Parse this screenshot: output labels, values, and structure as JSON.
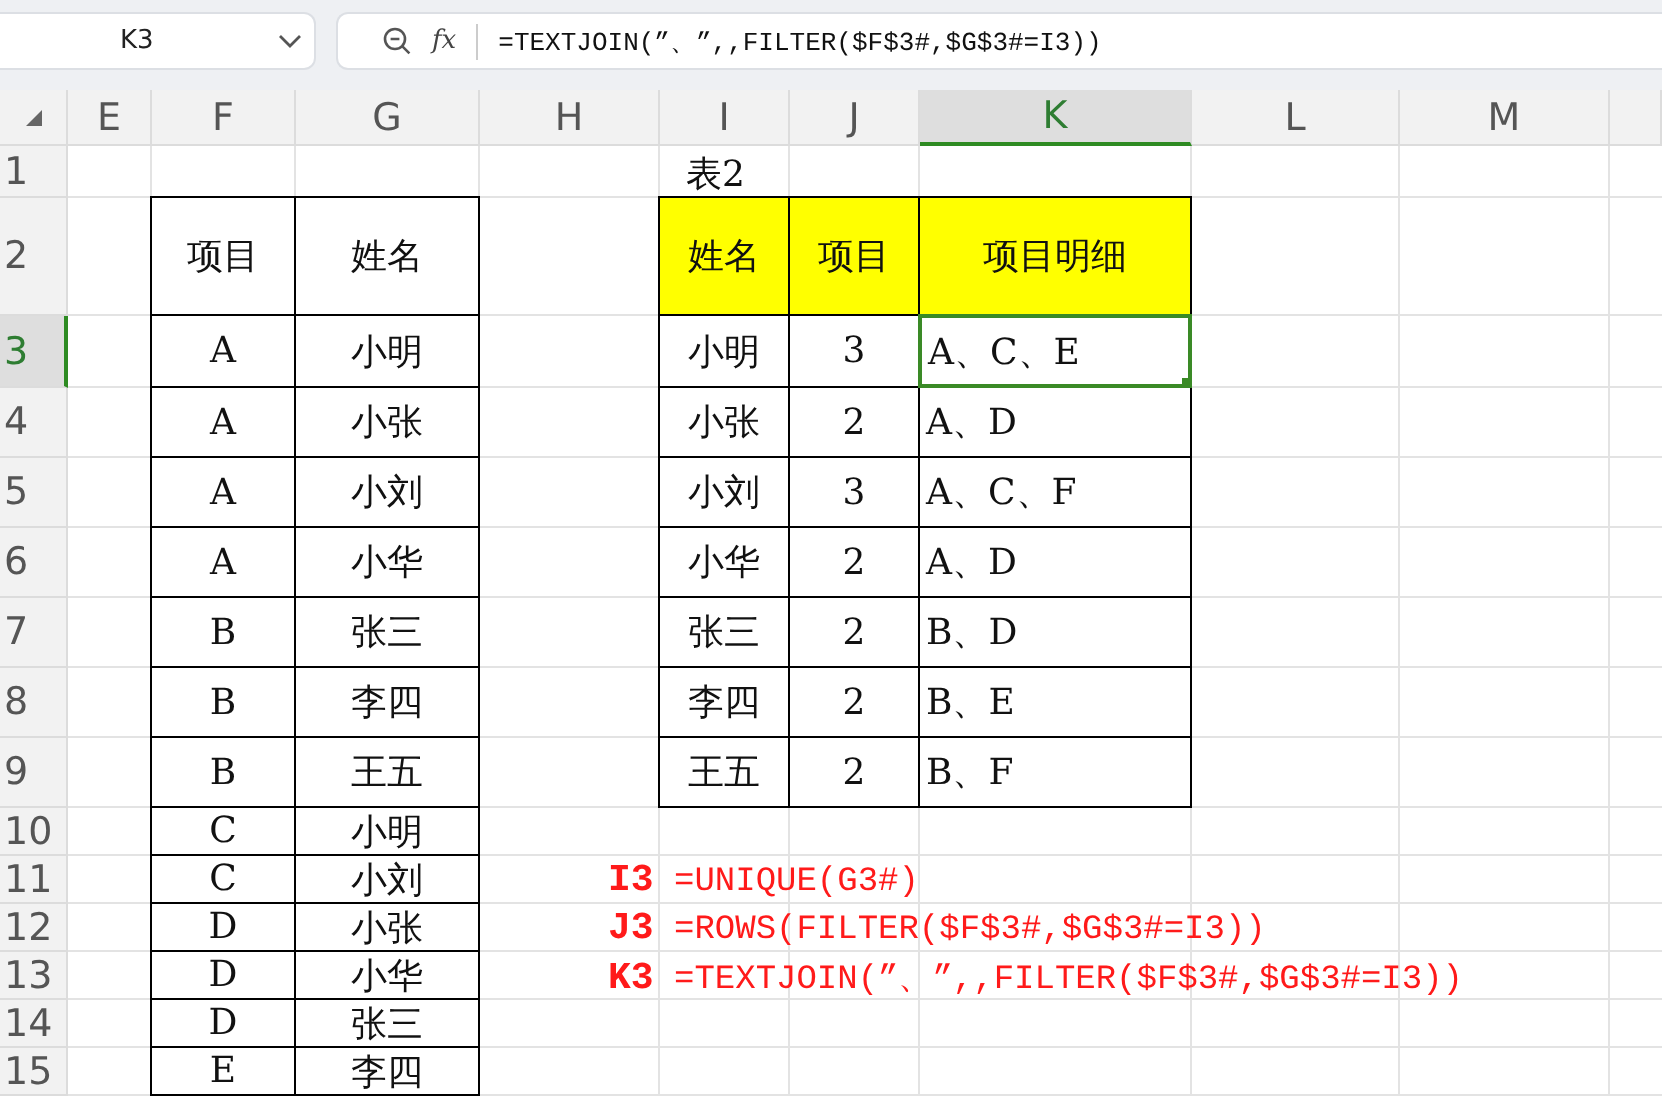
{
  "name_box": {
    "value": "K3"
  },
  "formula_bar": {
    "fx_label": "fx",
    "formula": "=TEXTJOIN(”、”,,FILTER($F$3#,$G$3#=I3))"
  },
  "columns": [
    {
      "label": "E",
      "selected": false
    },
    {
      "label": "F",
      "selected": false
    },
    {
      "label": "G",
      "selected": false
    },
    {
      "label": "H",
      "selected": false
    },
    {
      "label": "I",
      "selected": false
    },
    {
      "label": "J",
      "selected": false
    },
    {
      "label": "K",
      "selected": true
    },
    {
      "label": "L",
      "selected": false
    },
    {
      "label": "M",
      "selected": false
    }
  ],
  "rows": [
    {
      "label": "1",
      "selected": false
    },
    {
      "label": "2",
      "selected": false
    },
    {
      "label": "3",
      "selected": true
    },
    {
      "label": "4",
      "selected": false
    },
    {
      "label": "5",
      "selected": false
    },
    {
      "label": "6",
      "selected": false
    },
    {
      "label": "7",
      "selected": false
    },
    {
      "label": "8",
      "selected": false
    },
    {
      "label": "9",
      "selected": false
    },
    {
      "label": "10",
      "selected": false
    },
    {
      "label": "11",
      "selected": false
    },
    {
      "label": "12",
      "selected": false
    },
    {
      "label": "13",
      "selected": false
    },
    {
      "label": "14",
      "selected": false
    },
    {
      "label": "15",
      "selected": false
    }
  ],
  "table1": {
    "headers": [
      "项目",
      "姓名"
    ],
    "rows": [
      {
        "item": "A",
        "name": "小明"
      },
      {
        "item": "A",
        "name": "小张"
      },
      {
        "item": "A",
        "name": "小刘"
      },
      {
        "item": "A",
        "name": "小华"
      },
      {
        "item": "B",
        "name": "张三"
      },
      {
        "item": "B",
        "name": "李四"
      },
      {
        "item": "B",
        "name": "王五"
      },
      {
        "item": "C",
        "name": "小明"
      },
      {
        "item": "C",
        "name": "小刘"
      },
      {
        "item": "D",
        "name": "小张"
      },
      {
        "item": "D",
        "name": "小华"
      },
      {
        "item": "D",
        "name": "张三"
      },
      {
        "item": "E",
        "name": "李四"
      }
    ]
  },
  "table2": {
    "title": "表2",
    "headers": [
      "姓名",
      "项目",
      "项目明细"
    ],
    "rows": [
      {
        "name": "小明",
        "count": "3",
        "detail": "A、C、E",
        "selected": true
      },
      {
        "name": "小张",
        "count": "2",
        "detail": "A、D",
        "selected": false
      },
      {
        "name": "小刘",
        "count": "3",
        "detail": "A、C、F",
        "selected": false
      },
      {
        "name": "小华",
        "count": "2",
        "detail": "A、D",
        "selected": false
      },
      {
        "name": "张三",
        "count": "2",
        "detail": "B、D",
        "selected": false
      },
      {
        "name": "李四",
        "count": "2",
        "detail": "B、E",
        "selected": false
      },
      {
        "name": "王五",
        "count": "2",
        "detail": "B、F",
        "selected": false
      }
    ]
  },
  "notes": [
    "**I3** =UNIQUE(G3#)",
    "**J3** =ROWS(FILTER($F$3#,$G$3#=I3))",
    "**K3** =TEXTJOIN(”、”,,FILTER($F$3#,$G$3#=I3))"
  ]
}
